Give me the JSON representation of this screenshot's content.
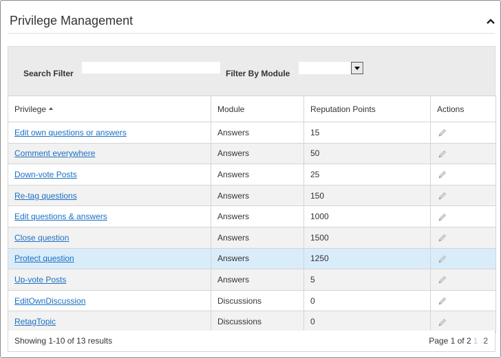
{
  "panel": {
    "title": "Privilege Management"
  },
  "filters": {
    "search_label": "Search Filter",
    "search_value": "",
    "module_label": "Filter By Module",
    "module_value": ""
  },
  "table": {
    "columns": [
      "Privilege",
      "Module",
      "Reputation Points",
      "Actions"
    ],
    "sorted_column": "Privilege",
    "sort_direction": "ascending",
    "rows": [
      {
        "privilege": "Edit own questions or answers",
        "module": "Answers",
        "points": "15"
      },
      {
        "privilege": "Comment everywhere",
        "module": "Answers",
        "points": "50"
      },
      {
        "privilege": "Down-vote Posts",
        "module": "Answers",
        "points": "25"
      },
      {
        "privilege": "Re-tag questions",
        "module": "Answers",
        "points": "150"
      },
      {
        "privilege": "Edit questions & answers",
        "module": "Answers",
        "points": "1000"
      },
      {
        "privilege": "Close question",
        "module": "Answers",
        "points": "1500"
      },
      {
        "privilege": "Protect question",
        "module": "Answers",
        "points": "1250"
      },
      {
        "privilege": "Up-vote Posts",
        "module": "Answers",
        "points": "5"
      },
      {
        "privilege": "EditOwnDiscussion",
        "module": "Discussions",
        "points": "0"
      },
      {
        "privilege": "RetagTopic",
        "module": "Discussions",
        "points": "0"
      }
    ],
    "selected_row_index": 6,
    "action_icon": "pencil-edit-icon"
  },
  "footer": {
    "summary": "Showing 1-10 of 13 results",
    "page_label": "Page 1 of 2",
    "current_page": "1",
    "next_page": "2"
  },
  "colors": {
    "link": "#1a6fc4",
    "selected_row": "#d9ecfa",
    "alt_row": "#f2f2f2",
    "filter_bar": "#ebebeb"
  }
}
